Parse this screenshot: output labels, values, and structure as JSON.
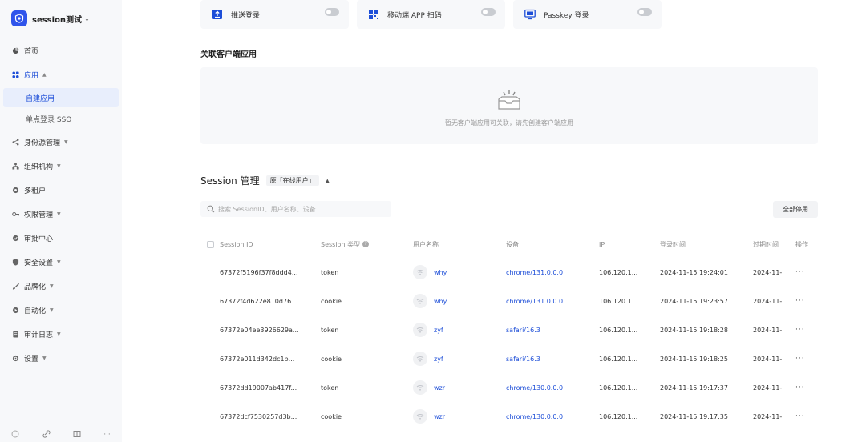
{
  "app": {
    "name": "session测试"
  },
  "nav": [
    {
      "id": "home",
      "label": "首页",
      "icon": "home-icon"
    },
    {
      "id": "apps",
      "label": "应用",
      "icon": "apps-icon",
      "expanded": true,
      "children": [
        {
          "label": "自建应用",
          "selected": true
        },
        {
          "label": "单点登录 SSO"
        }
      ]
    },
    {
      "id": "identity",
      "label": "身份源管理",
      "icon": "share-icon",
      "arrow": true
    },
    {
      "id": "org",
      "label": "组织机构",
      "icon": "org-icon",
      "arrow": true
    },
    {
      "id": "tenant",
      "label": "多租户",
      "icon": "tenant-icon"
    },
    {
      "id": "perm",
      "label": "权限管理",
      "icon": "key-icon",
      "arrow": true
    },
    {
      "id": "approval",
      "label": "审批中心",
      "icon": "approval-icon"
    },
    {
      "id": "security",
      "label": "安全设置",
      "icon": "shield-icon",
      "arrow": true
    },
    {
      "id": "brand",
      "label": "品牌化",
      "icon": "brush-icon",
      "arrow": true
    },
    {
      "id": "auto",
      "label": "自动化",
      "icon": "auto-icon",
      "arrow": true
    },
    {
      "id": "audit",
      "label": "审计日志",
      "icon": "log-icon",
      "arrow": true
    },
    {
      "id": "settings",
      "label": "设置",
      "icon": "gear-icon",
      "arrow": true
    }
  ],
  "login_methods": [
    {
      "label": "推送登录",
      "icon": "push-icon",
      "enabled": false
    },
    {
      "label": "移动端 APP 扫码",
      "icon": "qr-icon",
      "enabled": false
    },
    {
      "label": "Passkey 登录",
      "icon": "monitor-icon",
      "enabled": false
    }
  ],
  "linked_apps": {
    "title": "关联客户端应用",
    "empty_text": "暂无客户端应用可关联，请先创建客户端应用"
  },
  "session": {
    "title": "Session 管理",
    "tag": "原「在线用户」",
    "search_placeholder": "搜索 SessionID、用户名称、设备",
    "disable_all": "全部停用",
    "columns": [
      "Session ID",
      "Session 类型",
      "用户名称",
      "设备",
      "IP",
      "登录时间",
      "过期时间",
      "操作"
    ],
    "rows": [
      {
        "id": "67372f5196f37f8ddd4...",
        "type": "token",
        "user": "why",
        "device": "chrome/131.0.0.0",
        "ip": "106.120.1...",
        "login": "2024-11-15 19:24:01",
        "expire": "2024-11-"
      },
      {
        "id": "67372f4d622e810d76...",
        "type": "cookie",
        "user": "why",
        "device": "chrome/131.0.0.0",
        "ip": "106.120.1...",
        "login": "2024-11-15 19:23:57",
        "expire": "2024-11-"
      },
      {
        "id": "67372e04ee3926629a...",
        "type": "token",
        "user": "zyf",
        "device": "safari/16.3",
        "ip": "106.120.1...",
        "login": "2024-11-15 19:18:28",
        "expire": "2024-11-"
      },
      {
        "id": "67372e011d342dc1b...",
        "type": "cookie",
        "user": "zyf",
        "device": "safari/16.3",
        "ip": "106.120.1...",
        "login": "2024-11-15 19:18:25",
        "expire": "2024-11-"
      },
      {
        "id": "67372dd19007ab417f...",
        "type": "token",
        "user": "wzr",
        "device": "chrome/130.0.0.0",
        "ip": "106.120.1...",
        "login": "2024-11-15 19:17:37",
        "expire": "2024-11-"
      },
      {
        "id": "67372dcf7530257d3b...",
        "type": "cookie",
        "user": "wzr",
        "device": "chrome/130.0.0.0",
        "ip": "106.120.1...",
        "login": "2024-11-15 19:17:35",
        "expire": "2024-11-"
      }
    ],
    "more_label": "···"
  },
  "colors": {
    "accent": "#1d4ed8",
    "logo": "#2f54eb",
    "sidebar_bg": "#f7f8fa"
  }
}
